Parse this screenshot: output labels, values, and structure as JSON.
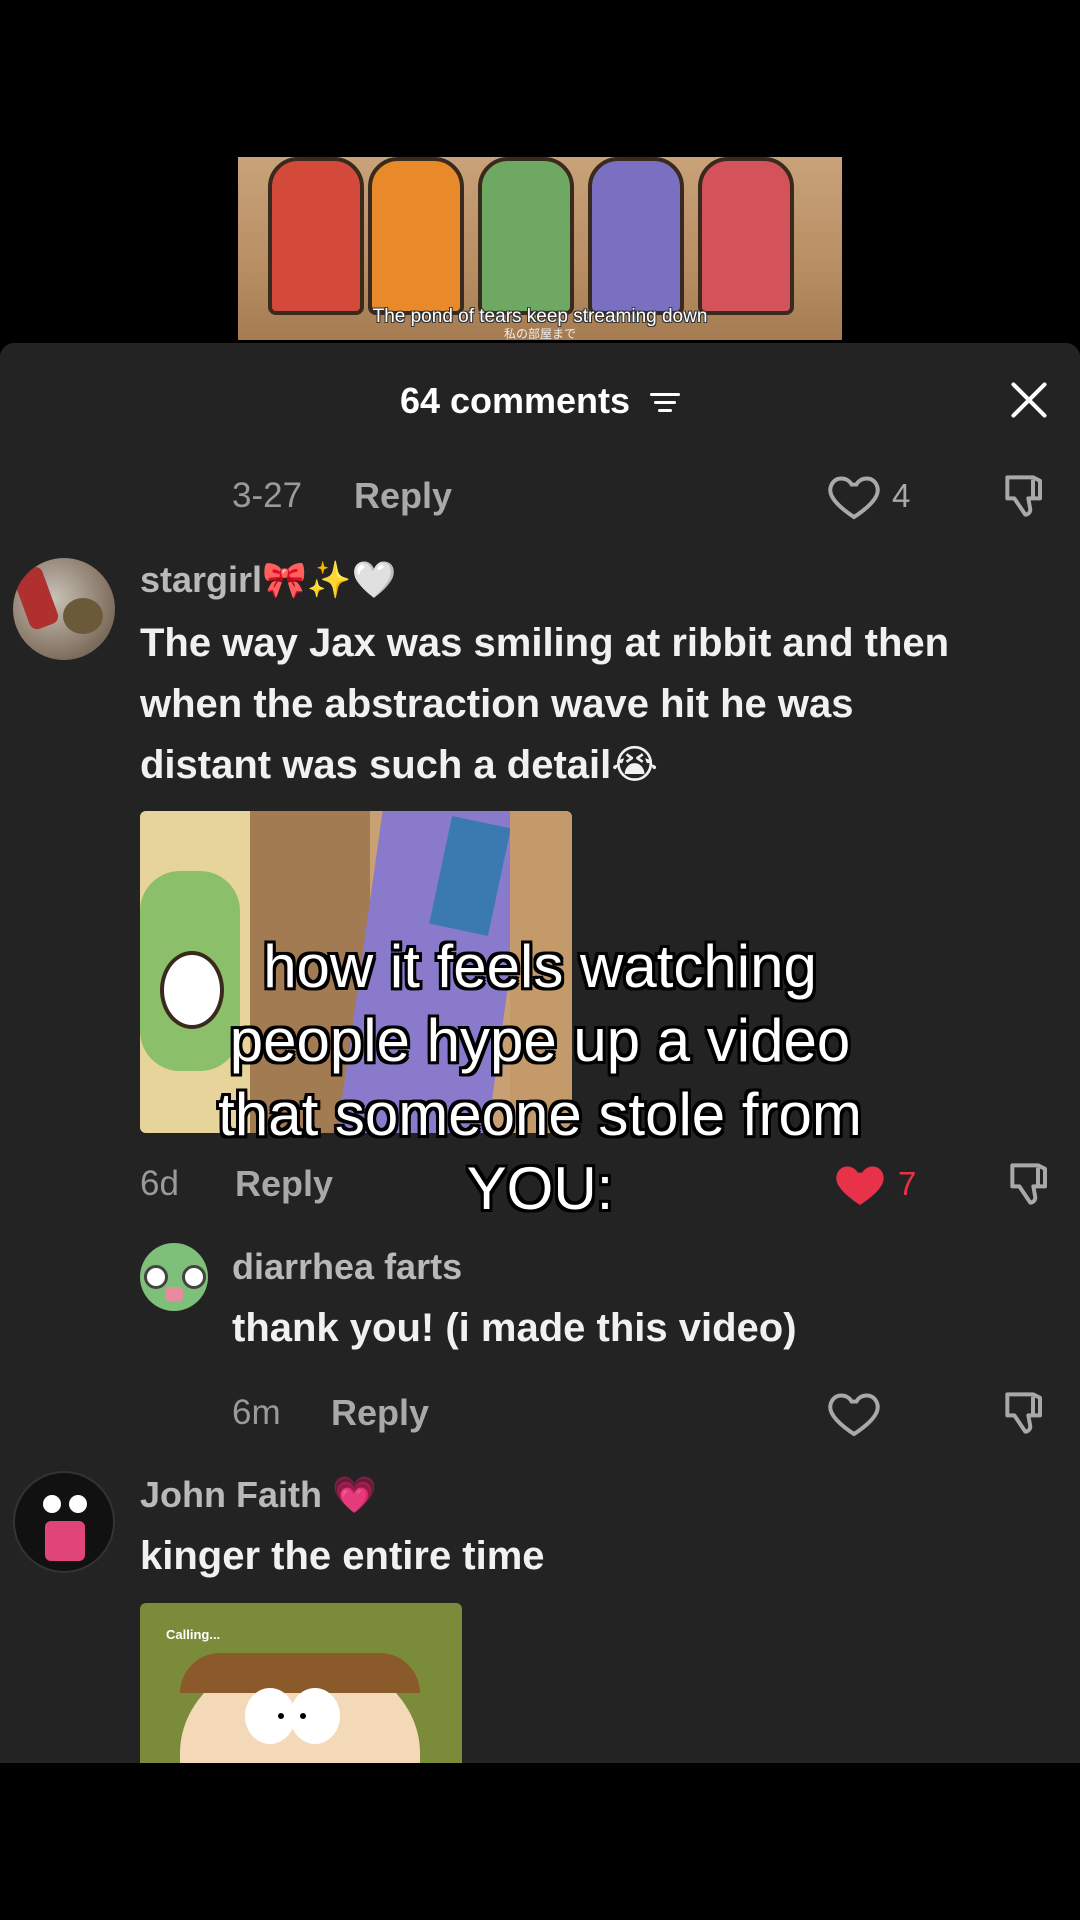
{
  "video": {
    "subtitle": "The pond of tears keep streaming down",
    "subtitle_jp": "私の部屋まで"
  },
  "comments_header": {
    "title": "64 comments",
    "filter_icon": "sort-filter-icon",
    "close_icon": "close-icon"
  },
  "prev_reply": {
    "date": "3-27",
    "reply_label": "Reply",
    "likes": "4"
  },
  "comments": [
    {
      "username": "stargirl🎀✨🤍",
      "text_lines": [
        "The way Jax was smiling at ribbit and then",
        "when the abstraction wave hit he was",
        "distant was such a detail😭"
      ],
      "age": "6d",
      "reply_label": "Reply",
      "likes": "7",
      "liked": true,
      "reply": {
        "username": "diarrhea  farts",
        "text": "thank you! (i made this video)",
        "age": "6m",
        "reply_label": "Reply"
      }
    },
    {
      "username": "John Faith 💗",
      "text": "kinger the entire time",
      "attachment_caption": "Calling..."
    }
  ],
  "overlay_caption": [
    "how it feels watching",
    "people hype up a video",
    "that someone stole from",
    "YOU:"
  ],
  "colors": {
    "sheet_bg": "#232323",
    "like_red": "#e8324a",
    "muted": "#a9a9a9"
  }
}
